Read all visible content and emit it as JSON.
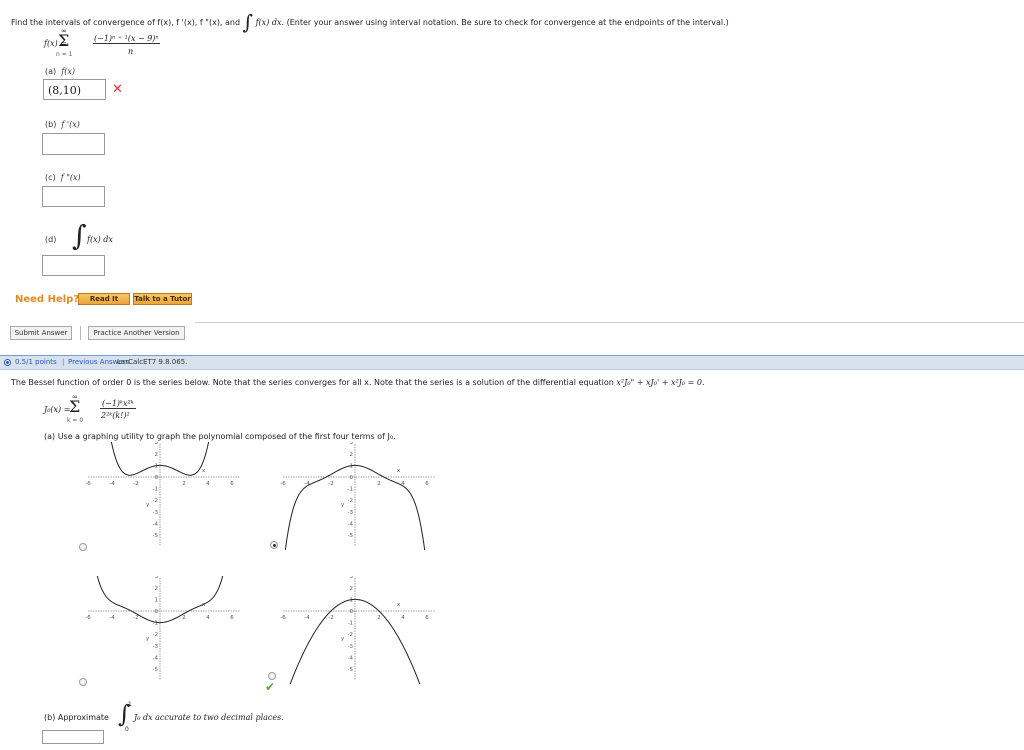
{
  "q1": {
    "instruction_prefix": "Find the intervals of convergence of f(x), f '(x), f \"(x), and",
    "instruction_mid": "f(x) dx.",
    "instruction_suffix": "(Enter your answer using interval notation. Be sure to check for convergence at the endpoints of the interval.)",
    "series_lhs": "f(x) =",
    "sum_top": "∞",
    "sum_bottom": "n = 1",
    "numerator": "(−1)ⁿ ⁺ ¹(x − 9)ⁿ",
    "denominator": "n",
    "parts": [
      {
        "label": "(a)",
        "expr": "f(x)",
        "answer": "(8,10)",
        "status": "incorrect"
      },
      {
        "label": "(b)",
        "expr": "f '(x)",
        "answer": ""
      },
      {
        "label": "(c)",
        "expr": "f \"(x)",
        "answer": ""
      },
      {
        "label": "(d)",
        "expr": "f(x) dx",
        "answer": ""
      }
    ],
    "need_help": "Need Help?",
    "read_it": "Read It",
    "talk_tutor": "Talk to a Tutor",
    "submit": "Submit Answer",
    "practice": "Practice Another Version"
  },
  "q2": {
    "points": "0.5/1 points",
    "prev_answers": "Previous Answers",
    "code": "LarCalcET7 9.8.065.",
    "statement": "The Bessel function of order 0 is the series below. Note that the series converges for all x. Note that the series is a solution of the differential equation",
    "equation": "x²J₀\" + xJ₀' + x²J₀ = 0.",
    "series_lhs": "J₀(x) =",
    "sum_top": "∞",
    "sum_bottom": "k = 0",
    "numerator": "(−1)ᵏx²ᵏ",
    "denominator": "2²ᵏ(k!)²",
    "part_a": "(a) Use a graphing utility to graph the polynomial composed of the first four terms of J₀.",
    "part_b_label": "(b) Approximate",
    "integral_upper": "1",
    "integral_lower": "0",
    "part_b_integrand": "J₀ dx accurate to two decimal places.",
    "graph_ticks": {
      "x": [
        "-6",
        "-4",
        "-2",
        "2",
        "4",
        "6"
      ],
      "y": [
        "3",
        "2",
        "1",
        "0",
        "-1",
        "-2",
        "-3",
        "-4",
        "-5"
      ],
      "x_label": "x",
      "y_label": "y"
    },
    "graphs": [
      {
        "id": "g1",
        "selected": false
      },
      {
        "id": "g2",
        "selected": true
      },
      {
        "id": "g3",
        "selected": false
      },
      {
        "id": "g4",
        "selected": false,
        "correct": true
      }
    ],
    "colors": {
      "incorrect": "#e8322e",
      "correct": "#5aa83a",
      "link": "#1f5bb7",
      "help": "#e58a1f"
    }
  }
}
